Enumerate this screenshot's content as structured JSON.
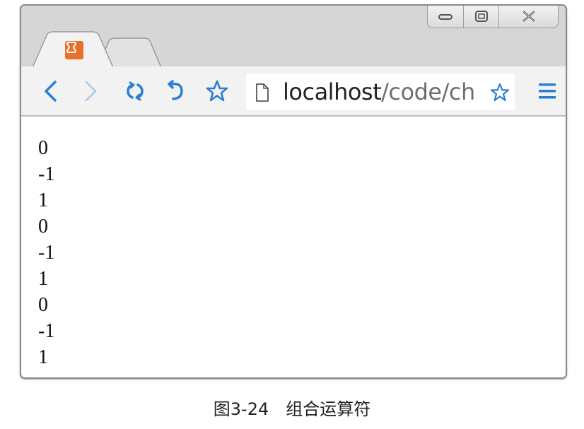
{
  "browser": {
    "tabs": [
      {
        "label": "",
        "active": true,
        "favicon": "xampp-icon"
      },
      {
        "label": "",
        "active": false
      }
    ],
    "address_bar": {
      "host": "localhost",
      "path": "/code/ch"
    },
    "icons": {
      "back": "back-icon",
      "forward": "forward-icon",
      "reload": "reload-icon",
      "undo": "undo-icon",
      "bookmark": "star-icon",
      "page": "page-icon",
      "menu": "menu-icon"
    },
    "colors": {
      "accent": "#2a7fd4",
      "favicon": "#e8702a"
    }
  },
  "content": {
    "lines": [
      "0",
      "-1",
      "1",
      "0",
      "-1",
      "1",
      "0",
      "-1",
      "1"
    ]
  },
  "caption": "图3-24　组合运算符"
}
